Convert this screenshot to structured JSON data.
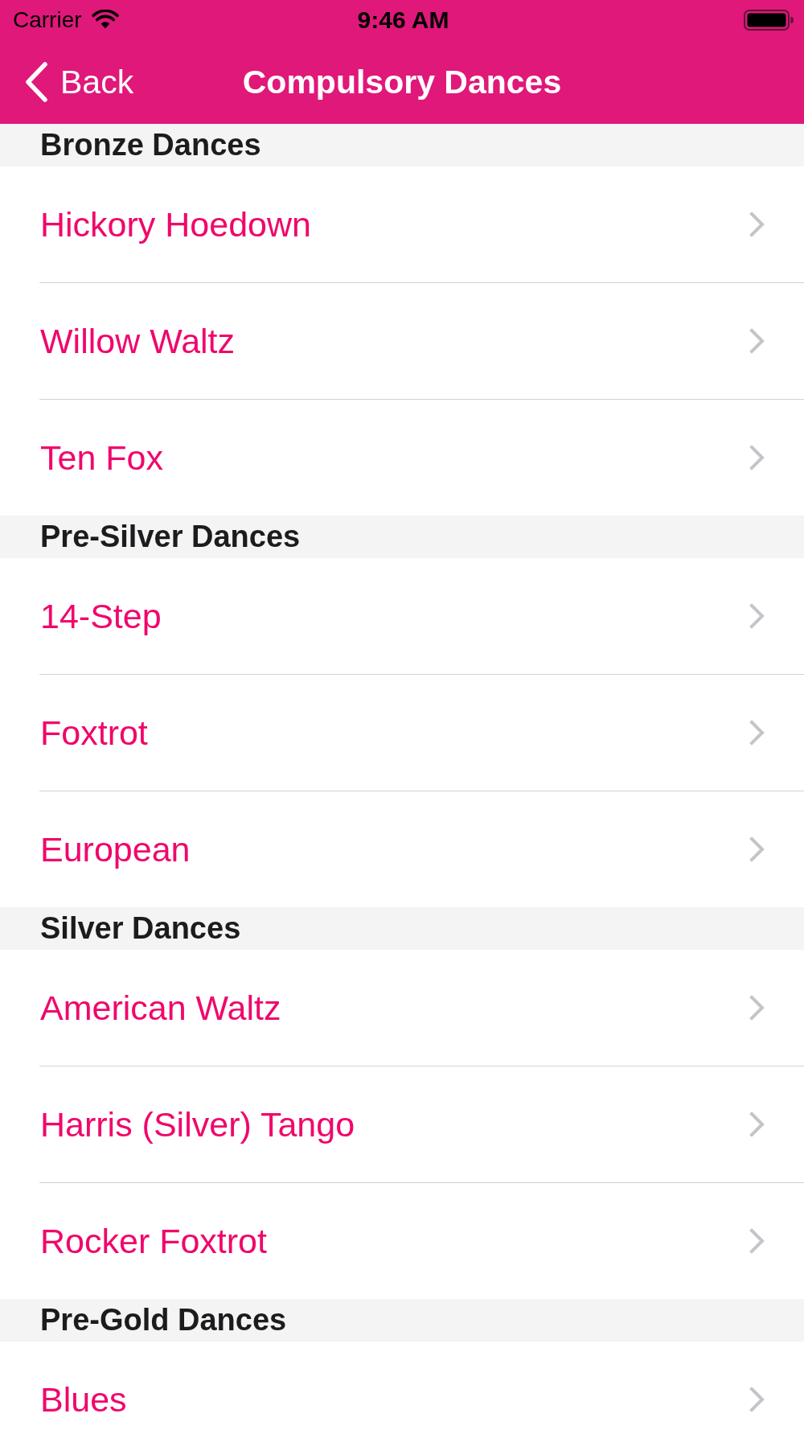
{
  "status_bar": {
    "carrier": "Carrier",
    "time": "9:46 AM"
  },
  "nav_bar": {
    "back_label": "Back",
    "title": "Compulsory Dances"
  },
  "sections": [
    {
      "title": "Bronze Dances",
      "items": [
        "Hickory Hoedown",
        "Willow Waltz",
        "Ten Fox"
      ]
    },
    {
      "title": "Pre-Silver Dances",
      "items": [
        "14-Step",
        "Foxtrot",
        "European"
      ]
    },
    {
      "title": "Silver Dances",
      "items": [
        "American Waltz",
        "Harris (Silver) Tango",
        "Rocker Foxtrot"
      ]
    },
    {
      "title": "Pre-Gold Dances",
      "items": [
        "Blues"
      ]
    }
  ]
}
